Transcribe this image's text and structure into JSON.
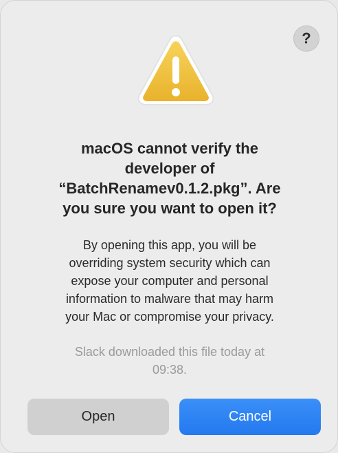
{
  "dialog": {
    "help_label": "?",
    "icon": "warning-triangle-icon",
    "title_lines": [
      "macOS cannot verify the",
      "developer of",
      "“BatchRenamev0.1.2.pkg”. Are",
      "you sure you want to open it?"
    ],
    "message_lines": [
      "By opening this app, you will be",
      "overriding system security which can",
      "expose your computer and personal",
      "information to malware that may harm",
      "your Mac or compromise your privacy."
    ],
    "source_note_lines": [
      "Slack downloaded this file today at",
      "09:38."
    ],
    "buttons": {
      "open_label": "Open",
      "cancel_label": "Cancel"
    }
  },
  "colors": {
    "accent": "#2f86f5",
    "warning": "#f2c440",
    "dialog_bg": "#ececec"
  }
}
